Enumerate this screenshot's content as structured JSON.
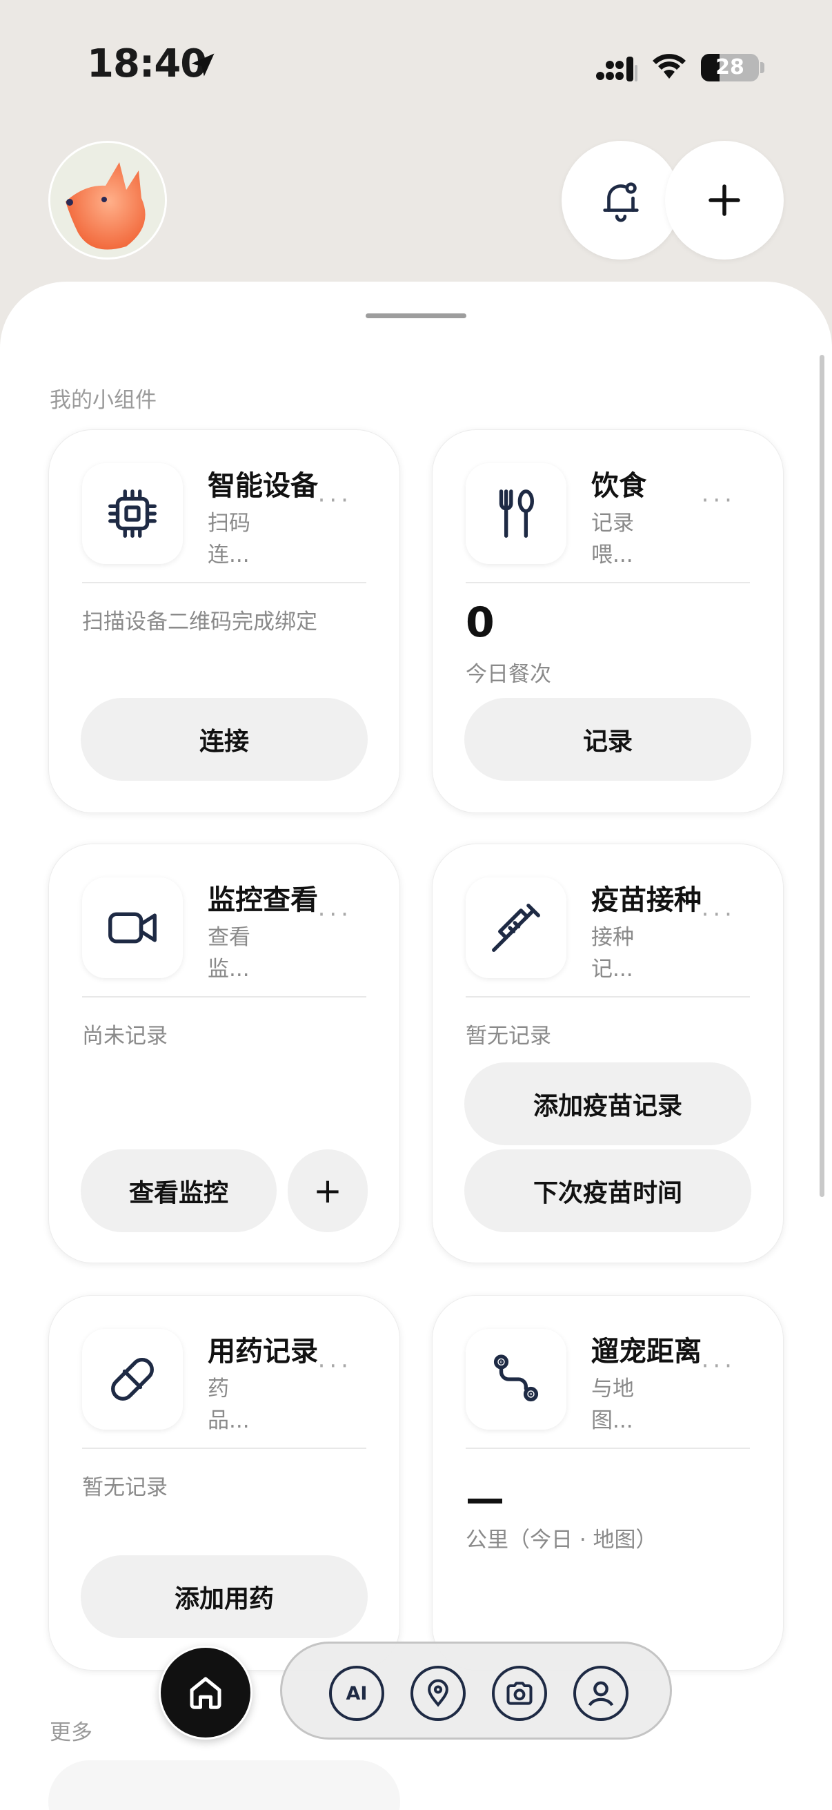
{
  "status_bar": {
    "time": "18:40",
    "battery": "28"
  },
  "sections": {
    "widgets_label": "我的小组件",
    "more_label": "更多"
  },
  "cards": {
    "smart_device": {
      "title": "智能设备",
      "subtitle": "扫码\n连...",
      "more": "···",
      "desc": "扫描设备二维码完成绑定",
      "button": "连接"
    },
    "diet": {
      "title": "饮食",
      "subtitle": "记录\n喂...",
      "more": "···",
      "value": "0",
      "value_label": "今日餐次",
      "button": "记录"
    },
    "monitor": {
      "title": "监控查看",
      "subtitle": "查看\n监...",
      "more": "···",
      "desc": "尚未记录",
      "button": "查看监控",
      "add_button": "+"
    },
    "vaccine": {
      "title": "疫苗接种",
      "subtitle": "接种\n记...",
      "more": "···",
      "desc": "暂无记录",
      "button_add": "添加疫苗记录",
      "button_next": "下次疫苗时间"
    },
    "medicine": {
      "title": "用药记录",
      "subtitle": "药\n品...",
      "more": "···",
      "desc": "暂无记录",
      "button": "添加用药"
    },
    "walk": {
      "title": "遛宠距离",
      "subtitle": "与地\n图...",
      "more": "···",
      "value": "—",
      "value_label": "公里（今日 · 地图）"
    }
  },
  "nav": {
    "ai_label": "AI",
    "items": [
      "home-icon",
      "ai-icon",
      "location-icon",
      "camera-icon",
      "profile-icon"
    ]
  },
  "colors": {
    "background": "#ebe8e4",
    "sheet": "#ffffff",
    "button": "#f0f0f0",
    "icon_stroke": "#1e2a44"
  }
}
